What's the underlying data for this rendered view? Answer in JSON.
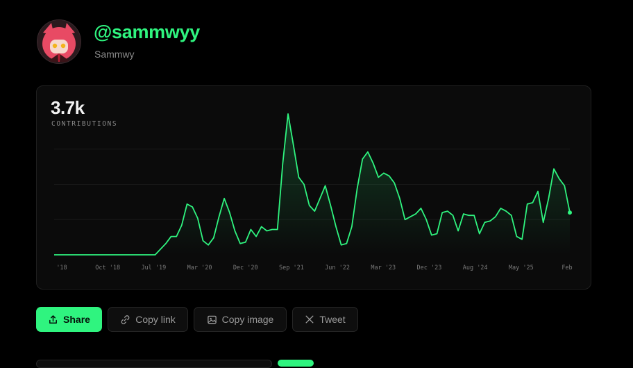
{
  "profile": {
    "username": "@sammwyy",
    "display_name": "Sammwy"
  },
  "summary": {
    "total": "3.7k",
    "label": "CONTRIBUTIONS"
  },
  "colors": {
    "accent": "#2ff47f",
    "background": "#000000",
    "card": "#0b0b0b"
  },
  "actions": {
    "share": "Share",
    "copy_link": "Copy link",
    "copy_image": "Copy image",
    "tweet": "Tweet"
  },
  "chart_data": {
    "type": "area",
    "title": "",
    "xlabel": "",
    "ylabel": "",
    "grid": true,
    "x_tick_labels": [
      "'18",
      "Oct '18",
      "Jul '19",
      "Mar '20",
      "Dec '20",
      "Sep '21",
      "Jun '22",
      "Mar '23",
      "Dec '23",
      "Aug '24",
      "May '25",
      "Feb"
    ],
    "ylim": [
      0,
      200
    ],
    "series": [
      {
        "values": [
          0,
          0,
          0,
          0,
          0,
          0,
          0,
          0,
          0,
          0,
          0,
          0,
          0,
          0,
          0,
          0,
          0,
          0,
          0,
          0,
          8,
          16,
          26,
          26,
          42,
          72,
          68,
          52,
          20,
          14,
          24,
          54,
          80,
          60,
          34,
          16,
          18,
          36,
          26,
          40,
          34,
          36,
          36,
          130,
          200,
          156,
          110,
          100,
          70,
          62,
          80,
          98,
          70,
          40,
          14,
          16,
          40,
          94,
          136,
          146,
          130,
          110,
          116,
          112,
          102,
          80,
          50,
          54,
          58,
          66,
          50,
          28,
          30,
          60,
          62,
          56,
          34,
          58,
          56,
          56,
          30,
          46,
          48,
          54,
          66,
          62,
          56,
          26,
          22,
          72,
          74,
          90,
          46,
          80,
          122,
          108,
          98,
          60
        ],
        "point_style": "line+fill"
      }
    ]
  }
}
